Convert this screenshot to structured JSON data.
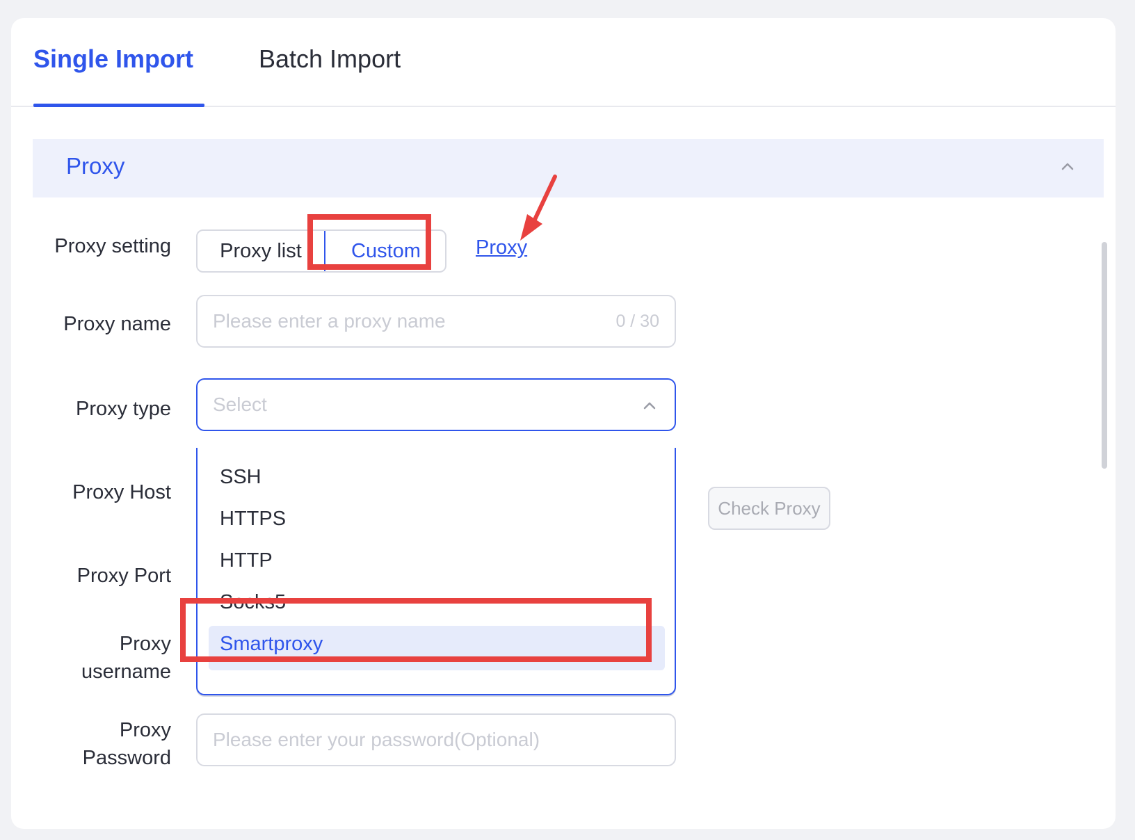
{
  "tabs": [
    {
      "label": "Single Import"
    },
    {
      "label": "Batch Import"
    }
  ],
  "section": {
    "title": "Proxy",
    "icon": "chevron-up-icon"
  },
  "proxy_setting": {
    "label": "Proxy setting",
    "options": [
      "Proxy list",
      "Custom"
    ],
    "link": "Proxy"
  },
  "proxy_name": {
    "label": "Proxy name",
    "placeholder": "Please enter a proxy name",
    "counter": "0 / 30"
  },
  "proxy_type": {
    "label": "Proxy type",
    "placeholder": "Select",
    "options": [
      "SSH",
      "HTTPS",
      "HTTP",
      "Socks5",
      "Smartproxy"
    ]
  },
  "proxy_host": {
    "label": "Proxy Host",
    "check_button": "Check Proxy"
  },
  "proxy_port": {
    "label": "Proxy Port"
  },
  "proxy_username": {
    "label_line1": "Proxy",
    "label_line2": "username"
  },
  "proxy_password": {
    "label_line1": "Proxy",
    "label_line2": "Password",
    "placeholder": "Please enter your password(Optional)"
  },
  "annotation": {
    "color": "#e8413f"
  },
  "colors": {
    "accent": "#2f55eb",
    "highlight": "#e6ebfb"
  }
}
